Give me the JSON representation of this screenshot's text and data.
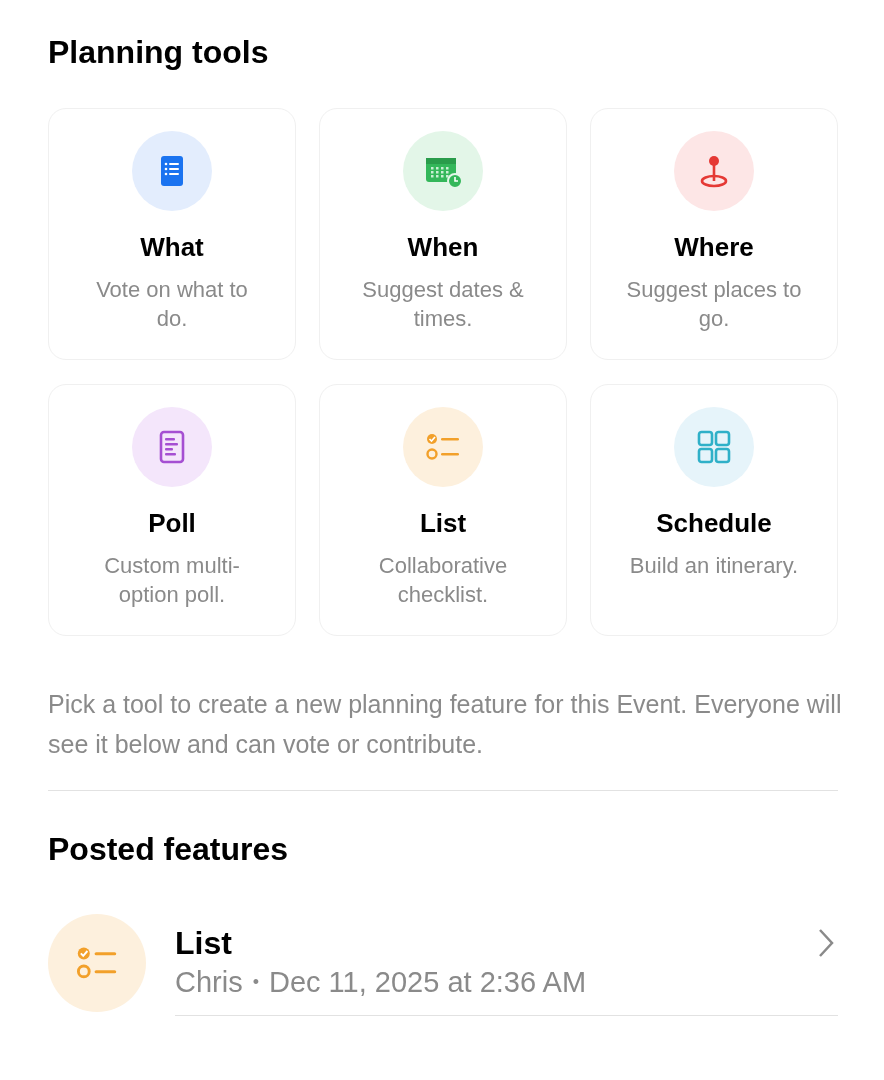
{
  "planning_tools": {
    "title": "Planning tools",
    "tools": [
      {
        "kind": "what",
        "name": "What",
        "description": "Vote on what to do."
      },
      {
        "kind": "when",
        "name": "When",
        "description": "Suggest dates & times."
      },
      {
        "kind": "where",
        "name": "Where",
        "description": "Suggest places to go."
      },
      {
        "kind": "poll",
        "name": "Poll",
        "description": "Custom multi-option poll."
      },
      {
        "kind": "list",
        "name": "List",
        "description": "Collaborative checklist."
      },
      {
        "kind": "schedule",
        "name": "Schedule",
        "description": "Build an itinerary."
      }
    ],
    "hint": "Pick a tool to create a new planning feature for this Event. Everyone will see it below and can vote or contribute."
  },
  "posted_features": {
    "title": "Posted features",
    "items": [
      {
        "kind": "list",
        "name": "List",
        "author": "Chris",
        "separator": "•",
        "date": "Dec 11, 2025 at 2:36 AM"
      }
    ]
  }
}
